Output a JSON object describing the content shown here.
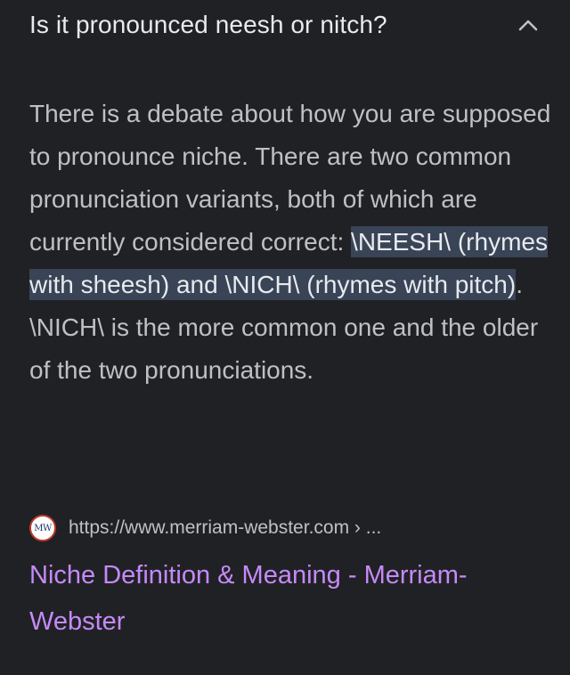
{
  "question": {
    "text": "Is it pronounced neesh or nitch?",
    "expanded": true,
    "chevron_icon": "chevron-up-icon"
  },
  "answer": {
    "text_before": "There is a debate about how you are supposed to pronounce niche. There are two common pronunciation variants, both of which are currently considered correct: ",
    "highlighted": "\\NEESH\\ (rhymes with sheesh) and \\NICH\\ (rhymes with pitch)",
    "text_after": ". \\NICH\\ is the more common one and the older of the two pronunciations."
  },
  "source": {
    "favicon_label": "MW",
    "url": "https://www.merriam-webster.com › ...",
    "title": "Niche Definition & Meaning - Merriam-Webster"
  },
  "colors": {
    "background": "#202124",
    "text": "#e8eaed",
    "secondary_text": "#bdc1c6",
    "highlight": "#394457",
    "link": "#c58af9"
  }
}
